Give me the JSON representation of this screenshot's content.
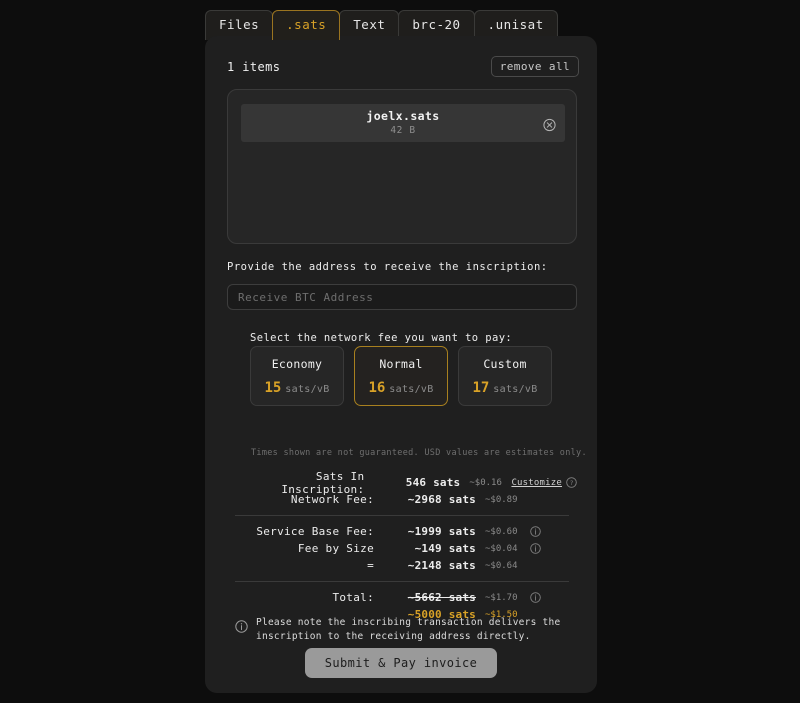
{
  "tabs": [
    {
      "label": "Files",
      "active": false
    },
    {
      "label": ".sats",
      "active": true
    },
    {
      "label": "Text",
      "active": false
    },
    {
      "label": "brc-20",
      "active": false
    },
    {
      "label": ".unisat",
      "active": false
    }
  ],
  "colors": {
    "accent_gold": "#d9a227",
    "panel_bg": "#1f1f1f",
    "page_bg": "#0d0d0d",
    "submit_bg": "#9a9a9a"
  },
  "toolbar": {
    "items_count": "1 items",
    "remove_all_label": "remove all"
  },
  "dropzone": {
    "file": {
      "name": "joelx.sats",
      "size": "42 B",
      "remove_icon": "circle-x-icon"
    }
  },
  "address": {
    "label": "Provide the address to receive the inscription:",
    "placeholder": "Receive BTC Address",
    "value": ""
  },
  "network_fee": {
    "label": "Select the network fee you want to pay:",
    "options": [
      {
        "name": "Economy",
        "rate": "15",
        "unit": "sats/vB",
        "selected": false
      },
      {
        "name": "Normal",
        "rate": "16",
        "unit": "sats/vB",
        "selected": true
      },
      {
        "name": "Custom",
        "rate": "17",
        "unit": "sats/vB",
        "selected": false
      }
    ],
    "disclaimer": "Times shown are not guaranteed. USD values are estimates only."
  },
  "breakdown": {
    "rows": [
      {
        "label": "Sats In Inscription:",
        "sats": "546 sats",
        "usd": "~$0.16",
        "extra": "Customize",
        "info": true
      },
      {
        "label": "Network Fee:",
        "sats": "~2968 sats",
        "usd": "~$0.89",
        "extra": "",
        "info": false
      }
    ],
    "service_rows": [
      {
        "label": "Service Base Fee:",
        "sats": "~1999 sats",
        "usd": "~$0.60",
        "info": true
      },
      {
        "label": "Fee by Size",
        "sats": "~149 sats",
        "usd": "~$0.04",
        "info": true
      },
      {
        "label": "=",
        "sats": "~2148 sats",
        "usd": "~$0.64",
        "info": false
      }
    ],
    "total": {
      "label": "Total:",
      "original_sats": "~5662 sats",
      "original_usd": "~$1.70",
      "final_sats": "~5000 sats",
      "final_usd": "~$1.50"
    },
    "customize_label": "Customize"
  },
  "footer": {
    "note": "Please note the inscribing transaction delivers the inscription to the receiving address directly.",
    "note_icon": "info-circle-icon",
    "submit_label": "Submit & Pay invoice"
  }
}
